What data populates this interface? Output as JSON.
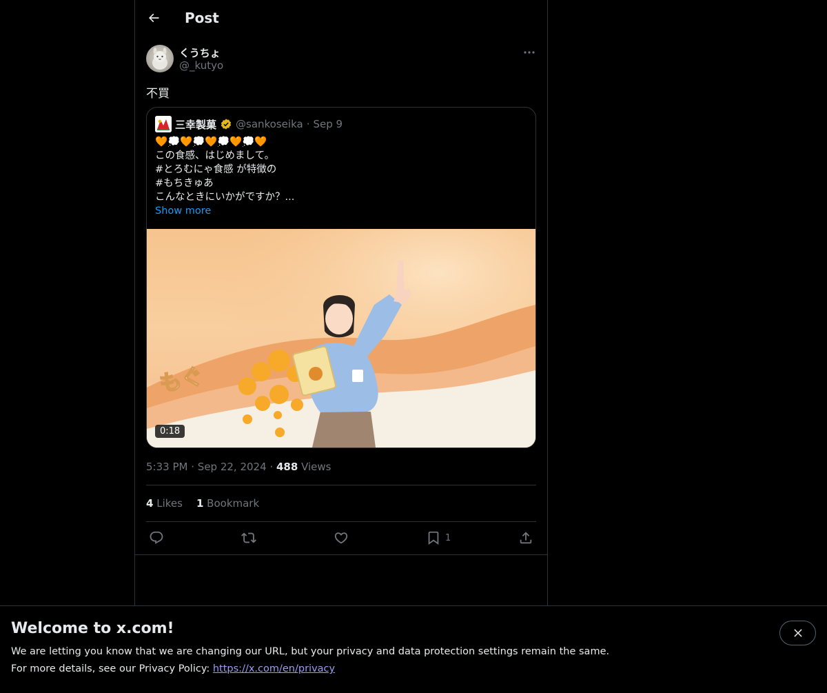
{
  "header": {
    "title": "Post",
    "back_icon": "arrow-left-icon"
  },
  "post": {
    "author_name": "くうちょ",
    "author_handle": "@_kutyo",
    "text": "不買",
    "timestamp": "5:33 PM",
    "date": "Sep 22, 2024",
    "separator": "·",
    "views_count": "488",
    "views_label": "Views",
    "likes_count": "4",
    "likes_label": "Likes",
    "bookmarks_count": "1",
    "bookmarks_label": "Bookmark",
    "bookmark_action_count": "1"
  },
  "quote": {
    "name": "三幸製菓",
    "verified_icon": "verified-gold-badge-icon",
    "handle": "@sankoseika",
    "separator": "·",
    "date": "Sep 9",
    "emoji_line": "🧡💭🧡💭🧡💭🧡💭🧡",
    "lines": [
      "この食感、はじめまして。",
      "#とろむにゃ食感 が特徴の",
      "#もちきゅあ",
      "こんなときにいかがですか？..."
    ],
    "show_more": "Show more",
    "media": {
      "overlay_text": "もぐ",
      "duration": "0:18"
    }
  },
  "actions": {
    "reply_icon": "reply-bubble-icon",
    "repost_icon": "repost-icon",
    "like_icon": "heart-icon",
    "bookmark_icon": "bookmark-icon",
    "share_icon": "share-icon"
  },
  "banner": {
    "title": "Welcome to x.com!",
    "line1": "We are letting you know that we are changing our URL, but your privacy and data protection settings remain the same.",
    "line2_prefix": "For more details, see our Privacy Policy: ",
    "link": "https://x.com/en/privacy",
    "close_icon": "close-x-icon"
  },
  "colors": {
    "background": "#000000",
    "text_primary": "#e7e9ea",
    "text_secondary": "#71767b",
    "border": "#2f3336",
    "accent_link": "#1d9bf0",
    "verified_gold": "#e2b719"
  }
}
